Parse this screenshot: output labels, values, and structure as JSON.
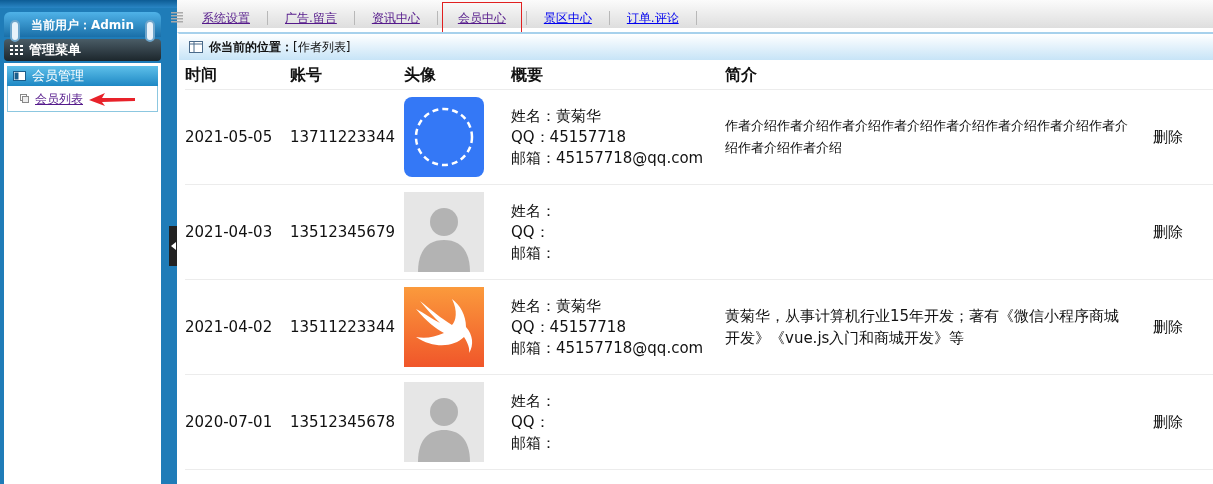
{
  "user_label": "当前用户：Admin",
  "nav": [
    {
      "label": "系统设置",
      "visited": true,
      "selected": false
    },
    {
      "label": "广告.留言",
      "visited": true,
      "selected": false
    },
    {
      "label": "资讯中心",
      "visited": true,
      "selected": false
    },
    {
      "label": "会员中心",
      "visited": true,
      "selected": true
    },
    {
      "label": "景区中心",
      "visited": false,
      "selected": false
    },
    {
      "label": "订单.评论",
      "visited": false,
      "selected": false
    }
  ],
  "sidebar": {
    "title": "管理菜单",
    "groups": [
      {
        "label": "会员管理",
        "items": [
          {
            "label": "会员列表",
            "visited": true,
            "pointed": true
          }
        ]
      }
    ]
  },
  "breadcrumb": {
    "label": "你当前的位置：",
    "path": "[作者列表]"
  },
  "table": {
    "columns": [
      "时间",
      "账号",
      "头像",
      "概要",
      "简介"
    ],
    "rows": [
      {
        "time": "2021-05-05",
        "account": "13711223344",
        "avatar": {
          "kind": "blue"
        },
        "summary": [
          "姓名：黄菊华",
          "QQ：45157718",
          "邮箱：45157718@qq.com"
        ],
        "intro": "作者介绍作者介绍作者介绍作者介绍作者介绍作者介绍作者介绍作者介绍作者介绍作者介绍",
        "small": true,
        "action": "删除"
      },
      {
        "time": "2021-04-03",
        "account": "13512345679",
        "avatar": {
          "kind": "silhouette"
        },
        "summary": [
          "姓名：",
          "QQ：",
          "邮箱："
        ],
        "action": "删除"
      },
      {
        "time": "2021-04-02",
        "account": "13511223344",
        "avatar": {
          "kind": "orange"
        },
        "summary": [
          "姓名：黄菊华",
          "QQ：45157718",
          "邮箱：45157718@qq.com"
        ],
        "intro": "黄菊华，从事计算机行业15年开发；著有《微信小程序商城开发》《vue.js入门和商城开发》等",
        "small": false,
        "action": "删除"
      },
      {
        "time": "2020-07-01",
        "account": "13512345678",
        "avatar": {
          "kind": "silhouette"
        },
        "summary": [
          "姓名：",
          "QQ：",
          "邮箱："
        ],
        "action": "删除"
      }
    ]
  }
}
